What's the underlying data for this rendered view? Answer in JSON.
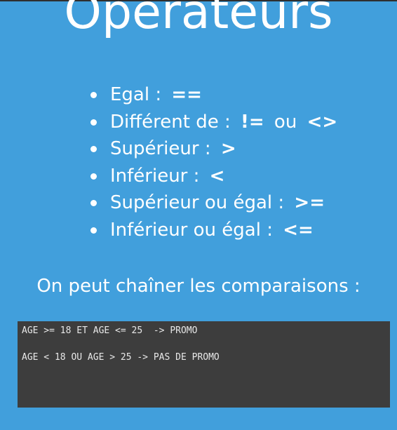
{
  "slide": {
    "title": "Opérateurs",
    "operators": [
      {
        "label": "Egal :",
        "symbols": [
          "=="
        ]
      },
      {
        "label": "Différent de :",
        "symbols": [
          "!=",
          "<>"
        ],
        "separator": "ou"
      },
      {
        "label": "Supérieur :",
        "symbols": [
          ">"
        ]
      },
      {
        "label": "Inférieur :",
        "symbols": [
          "<"
        ]
      },
      {
        "label": "Supérieur ou égal :",
        "symbols": [
          ">="
        ]
      },
      {
        "label": "Inférieur ou égal :",
        "symbols": [
          "<="
        ]
      }
    ],
    "chain_text": "On peut chaîner les comparaisons :",
    "code_lines": [
      "AGE >= 18 ET AGE <= 25  -> PROMO",
      "AGE < 18 OU AGE > 25 -> PAS DE PROMO"
    ]
  },
  "colors": {
    "background": "#419fdc",
    "code_background": "#3d3d3d",
    "text": "#ffffff"
  }
}
